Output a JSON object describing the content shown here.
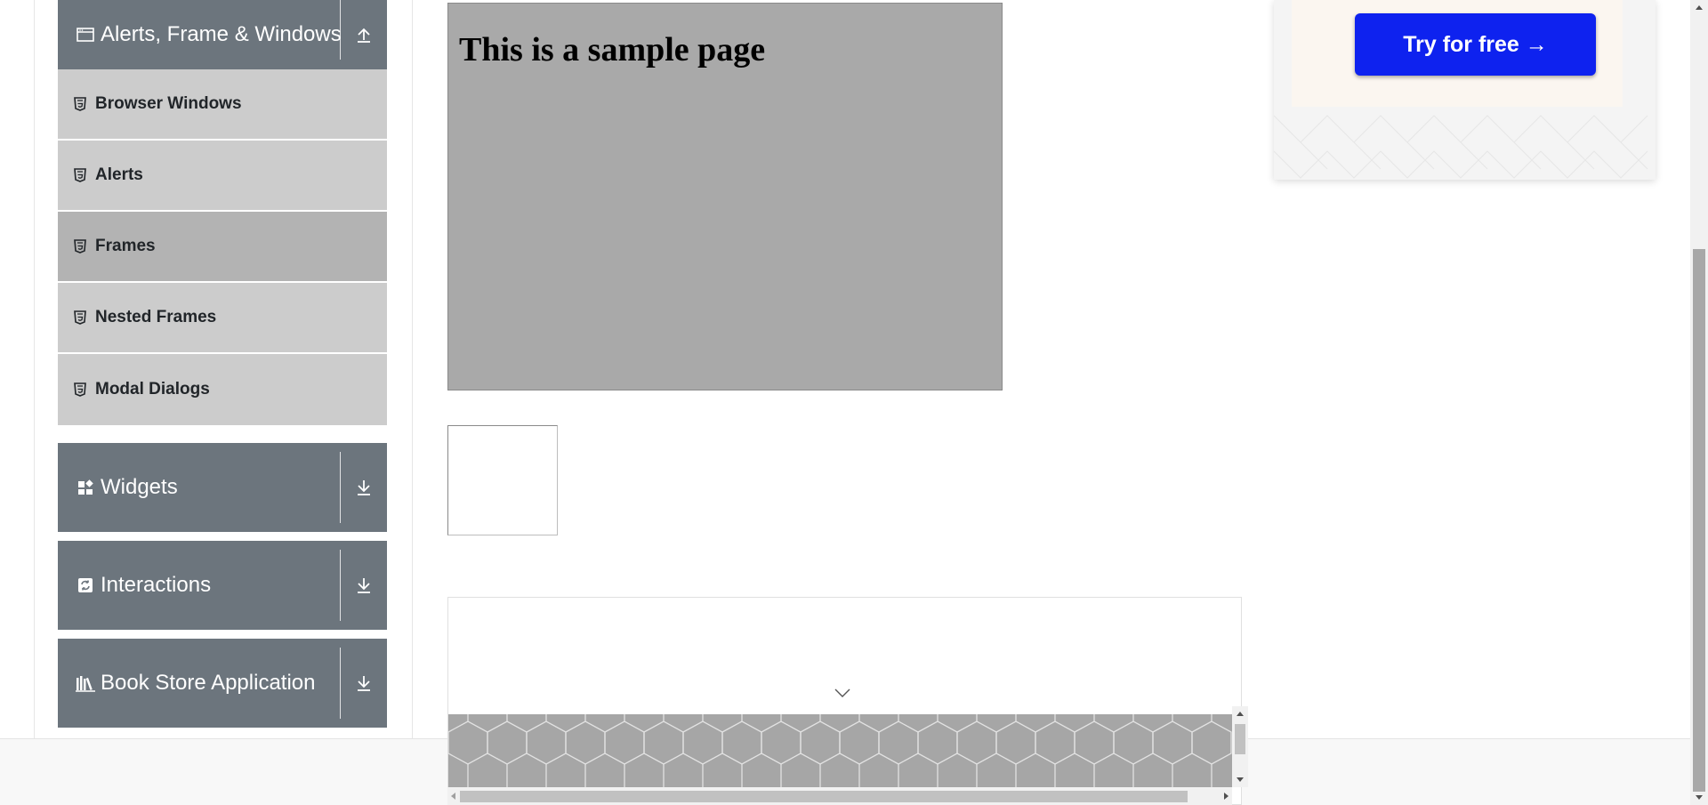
{
  "sidebar": {
    "alerts_group": {
      "title": "Alerts, Frame & Windows",
      "icon": "window-icon",
      "toggle_icon": "collapse-up-icon",
      "items": [
        {
          "label": "Browser Windows",
          "icon": "html5-icon"
        },
        {
          "label": "Alerts",
          "icon": "html5-icon"
        },
        {
          "label": "Frames",
          "icon": "html5-icon",
          "active": true
        },
        {
          "label": "Nested Frames",
          "icon": "html5-icon"
        },
        {
          "label": "Modal Dialogs",
          "icon": "html5-icon"
        }
      ]
    },
    "widgets_group": {
      "title": "Widgets",
      "icon": "widgets-icon",
      "toggle_icon": "expand-down-icon"
    },
    "interactions_group": {
      "title": "Interactions",
      "icon": "interactions-icon",
      "toggle_icon": "expand-down-icon"
    },
    "bookstore_group": {
      "title": "Book Store Application",
      "icon": "books-icon",
      "toggle_icon": "expand-down-icon"
    }
  },
  "main": {
    "frame1_heading": "This is a sample page"
  },
  "ad": {
    "button_label": "Try for free →",
    "button_color": "#0e22ef"
  },
  "colors": {
    "sidebar_header": "#6c757d",
    "sidebar_item": "#cccccc",
    "sidebar_item_active": "#b3b3b3",
    "frame_bg": "#a9a9a9"
  }
}
